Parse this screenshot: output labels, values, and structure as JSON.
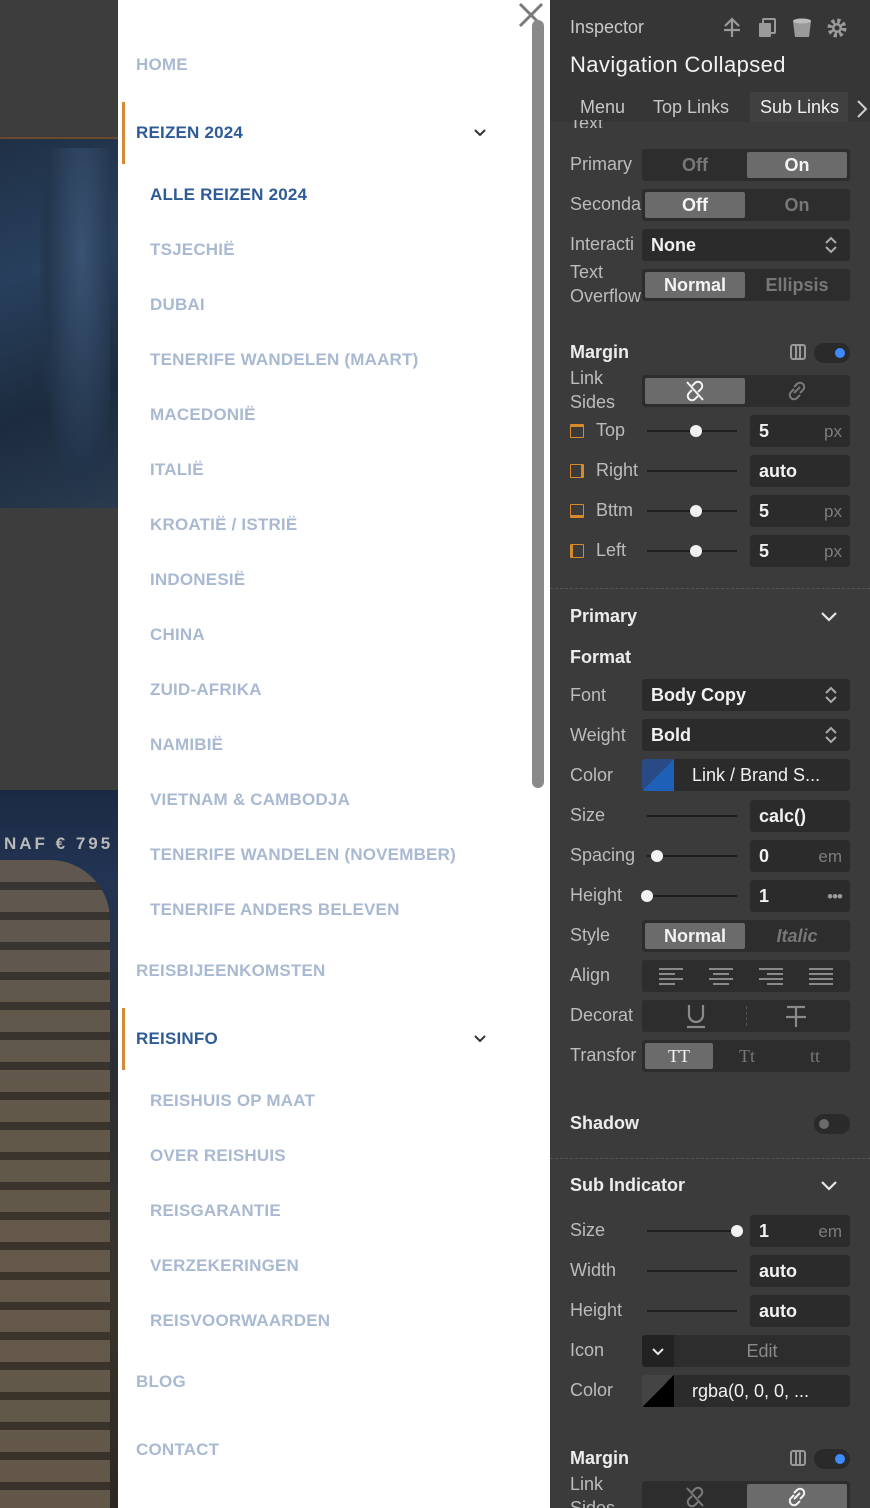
{
  "background": {
    "ticker_text": "NAF € 795"
  },
  "nav": {
    "items": [
      {
        "label": "HOME"
      },
      {
        "label": "REIZEN 2024"
      },
      {
        "label": "REISBIJEENKOMSTEN"
      },
      {
        "label": "REISINFO"
      },
      {
        "label": "BLOG"
      },
      {
        "label": "CONTACT"
      }
    ],
    "reizen_sub": [
      {
        "label": "ALLE REIZEN 2024"
      },
      {
        "label": "TSJECHIË"
      },
      {
        "label": "DUBAI"
      },
      {
        "label": "TENERIFE WANDELEN (MAART)"
      },
      {
        "label": "MACEDONIË"
      },
      {
        "label": "ITALIË"
      },
      {
        "label": "KROATIË / ISTRIË"
      },
      {
        "label": "INDONESIË"
      },
      {
        "label": "CHINA"
      },
      {
        "label": "ZUID-AFRIKA"
      },
      {
        "label": "NAMIBIË"
      },
      {
        "label": "VIETNAM & CAMBODJA"
      },
      {
        "label": "TENERIFE WANDELEN (NOVEMBER)"
      },
      {
        "label": "TENERIFE ANDERS BELEVEN"
      }
    ],
    "reisinfo_sub": [
      {
        "label": "REISHUIS OP MAAT"
      },
      {
        "label": "OVER REISHUIS"
      },
      {
        "label": "REISGARANTIE"
      },
      {
        "label": "VERZEKERINGEN"
      },
      {
        "label": "REISVOORWAARDEN"
      }
    ]
  },
  "inspector": {
    "label": "Inspector",
    "title": "Navigation Collapsed",
    "tabs": [
      "Menu",
      "Top Links",
      "Sub Links"
    ],
    "text_section": {
      "partial_heading": "Text",
      "primary_label": "Primary",
      "primary_off": "Off",
      "primary_on": "On",
      "secondary_label": "Seconda",
      "secondary_off": "Off",
      "secondary_on": "On",
      "interaction_label": "Interacti",
      "interaction_value": "None",
      "overflow_label_1": "Text",
      "overflow_label_2": "Overflow",
      "overflow_normal": "Normal",
      "overflow_ellipsis": "Ellipsis"
    },
    "margin": {
      "heading": "Margin",
      "link_sides_1": "Link",
      "link_sides_2": "Sides",
      "top_label": "Top",
      "top_value": "5",
      "top_unit": "px",
      "right_label": "Right",
      "right_value": "auto",
      "bottom_label": "Bttm",
      "bottom_value": "5",
      "bottom_unit": "px",
      "left_label": "Left",
      "left_value": "5",
      "left_unit": "px"
    },
    "primary": {
      "heading": "Primary",
      "format_heading": "Format",
      "font_label": "Font",
      "font_value": "Body Copy",
      "weight_label": "Weight",
      "weight_value": "Bold",
      "color_label": "Color",
      "color_value": "Link / Brand S...",
      "size_label": "Size",
      "size_value": "calc()",
      "spacing_label": "Spacing",
      "spacing_value": "0",
      "spacing_unit": "em",
      "height_label": "Height",
      "height_value": "1",
      "height_more": "•••",
      "style_label": "Style",
      "style_normal": "Normal",
      "style_italic": "Italic",
      "align_label": "Align",
      "decoration_label": "Decorat",
      "transform_label": "Transfor",
      "transform_upper": "TT",
      "transform_cap": "Tt",
      "transform_lower": "tt",
      "shadow_label": "Shadow"
    },
    "sub_indicator": {
      "heading": "Sub Indicator",
      "size_label": "Size",
      "size_value": "1",
      "size_unit": "em",
      "width_label": "Width",
      "width_value": "auto",
      "height_label": "Height",
      "height_value": "auto",
      "icon_label": "Icon",
      "icon_edit": "Edit",
      "color_label": "Color",
      "color_value": "rgba(0, 0, 0, ..."
    },
    "margin2": {
      "heading": "Margin",
      "link_sides_1": "Link",
      "link_sides_2": "Sides"
    }
  },
  "colors": {
    "nav_active": "#2e5b98",
    "nav_inactive": "#a9b9d2",
    "active_bar": "#d58a3a",
    "toggle_on": "#3d8bff"
  }
}
